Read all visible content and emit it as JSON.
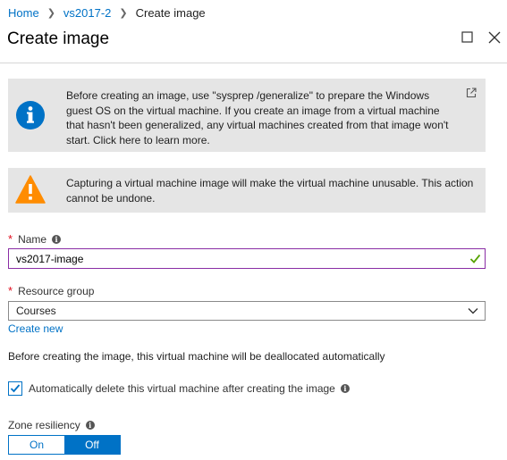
{
  "breadcrumb": {
    "items": [
      "Home",
      "vs2017-2"
    ],
    "current": "Create image"
  },
  "header": {
    "title": "Create image"
  },
  "info_notice": {
    "text": "Before creating an image, use \"sysprep /generalize\" to prepare the Windows guest OS on the virtual machine. If you create an image from a virtual machine that hasn't been generalized, any virtual machines created from that image won't start. Click here to learn more.",
    "icon": "info-icon",
    "link_icon": "external-link-icon"
  },
  "warning_notice": {
    "text": "Capturing a virtual machine image will make the virtual machine unusable. This action cannot be undone.",
    "icon": "warning-icon"
  },
  "form": {
    "name_label": "Name",
    "name_value": "vs2017-image",
    "resource_group_label": "Resource group",
    "resource_group_value": "Courses",
    "create_new": "Create new",
    "dealloc_note": "Before creating the image, this virtual machine will be deallocated automatically",
    "auto_delete_label": "Automatically delete this virtual machine after creating the image",
    "auto_delete_checked": true,
    "zone_label": "Zone resiliency",
    "zone_on": "On",
    "zone_off": "Off",
    "zone_selected": "Off"
  },
  "colors": {
    "accent": "#0072c6",
    "required": "#e00b1c",
    "valid_border": "#8a2da5",
    "valid_check": "#57a300",
    "warning": "#ff8c00",
    "notice_bg": "#e5e5e5"
  }
}
